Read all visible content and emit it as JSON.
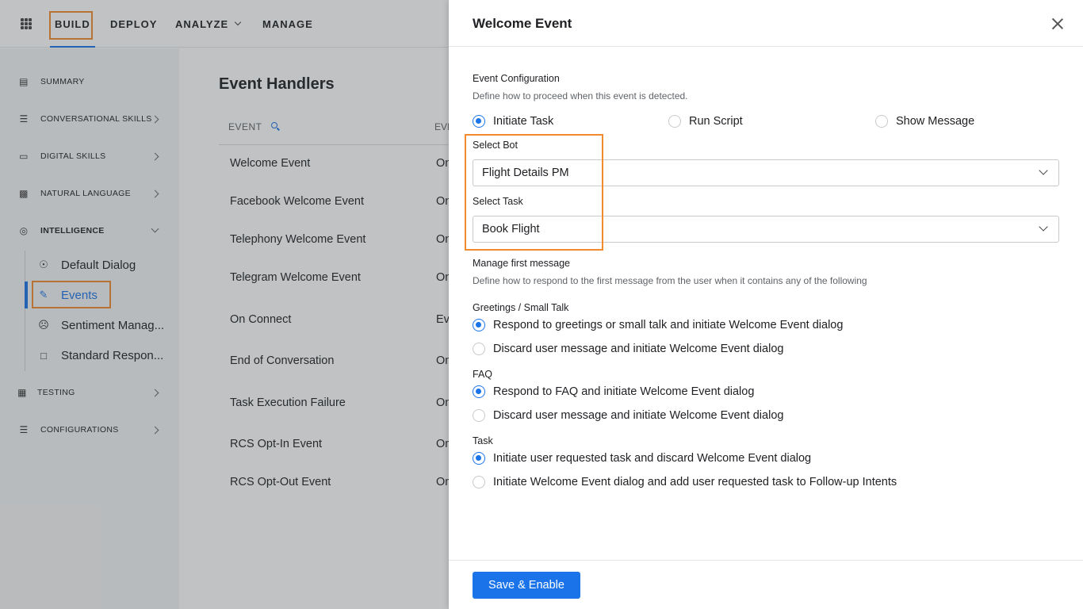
{
  "topnav": {
    "items": [
      {
        "label": "BUILD"
      },
      {
        "label": "DEPLOY"
      },
      {
        "label": "ANALYZE"
      },
      {
        "label": "MANAGE"
      }
    ]
  },
  "sidebar": {
    "items": [
      {
        "label": "SUMMARY"
      },
      {
        "label": "CONVERSATIONAL SKILLS"
      },
      {
        "label": "DIGITAL SKILLS"
      },
      {
        "label": "NATURAL LANGUAGE"
      },
      {
        "label": "INTELLIGENCE"
      },
      {
        "label": "TESTING"
      },
      {
        "label": "CONFIGURATIONS"
      }
    ],
    "subitems": [
      {
        "label": "Default Dialog"
      },
      {
        "label": "Events"
      },
      {
        "label": "Sentiment Manag..."
      },
      {
        "label": "Standard Respon..."
      }
    ]
  },
  "main": {
    "title": "Event Handlers",
    "column_event": "EVENT",
    "column_second": "EVEN",
    "rows": [
      {
        "name": "Welcome Event",
        "cut": "On"
      },
      {
        "name": "Facebook Welcome Event",
        "cut": "On"
      },
      {
        "name": "Telephony Welcome Event",
        "cut": "On"
      },
      {
        "name": "Telegram Welcome Event",
        "cut": "On"
      },
      {
        "name": "On Connect",
        "cut": "Ev"
      },
      {
        "name": "End of Conversation",
        "cut": "On"
      },
      {
        "name": "Task Execution Failure",
        "cut": "On"
      },
      {
        "name": "RCS Opt-In Event",
        "cut": "On"
      },
      {
        "name": "RCS Opt-Out Event",
        "cut": "On"
      }
    ]
  },
  "panel": {
    "title": "Welcome Event",
    "event_config_label": "Event Configuration",
    "event_config_desc": "Define how to proceed when this event is detected.",
    "config_options": [
      {
        "label": "Initiate Task",
        "selected": true
      },
      {
        "label": "Run Script",
        "selected": false
      },
      {
        "label": "Show Message",
        "selected": false
      }
    ],
    "select_bot_label": "Select Bot",
    "select_bot_value": "Flight Details PM",
    "select_task_label": "Select Task",
    "select_task_value": "Book Flight",
    "manage_label": "Manage first message",
    "manage_desc": "Define how to respond to the first message from the user when it contains any of the following",
    "greetings_label": "Greetings / Small Talk",
    "greetings_options": [
      {
        "label": "Respond to greetings or small talk and initiate Welcome Event dialog",
        "selected": true
      },
      {
        "label": "Discard user message and initiate Welcome Event dialog",
        "selected": false
      }
    ],
    "faq_label": "FAQ",
    "faq_options": [
      {
        "label": "Respond to FAQ and initiate Welcome Event dialog",
        "selected": true
      },
      {
        "label": "Discard user message and initiate Welcome Event dialog",
        "selected": false
      }
    ],
    "task_label": "Task",
    "task_options": [
      {
        "label": "Initiate user requested task and discard Welcome Event dialog",
        "selected": true
      },
      {
        "label": "Initiate Welcome Event dialog and add user requested task to Follow-up Intents",
        "selected": false
      }
    ],
    "save_label": "Save & Enable"
  },
  "colors": {
    "accent": "#1a73e8",
    "highlight": "#f28a2e"
  }
}
